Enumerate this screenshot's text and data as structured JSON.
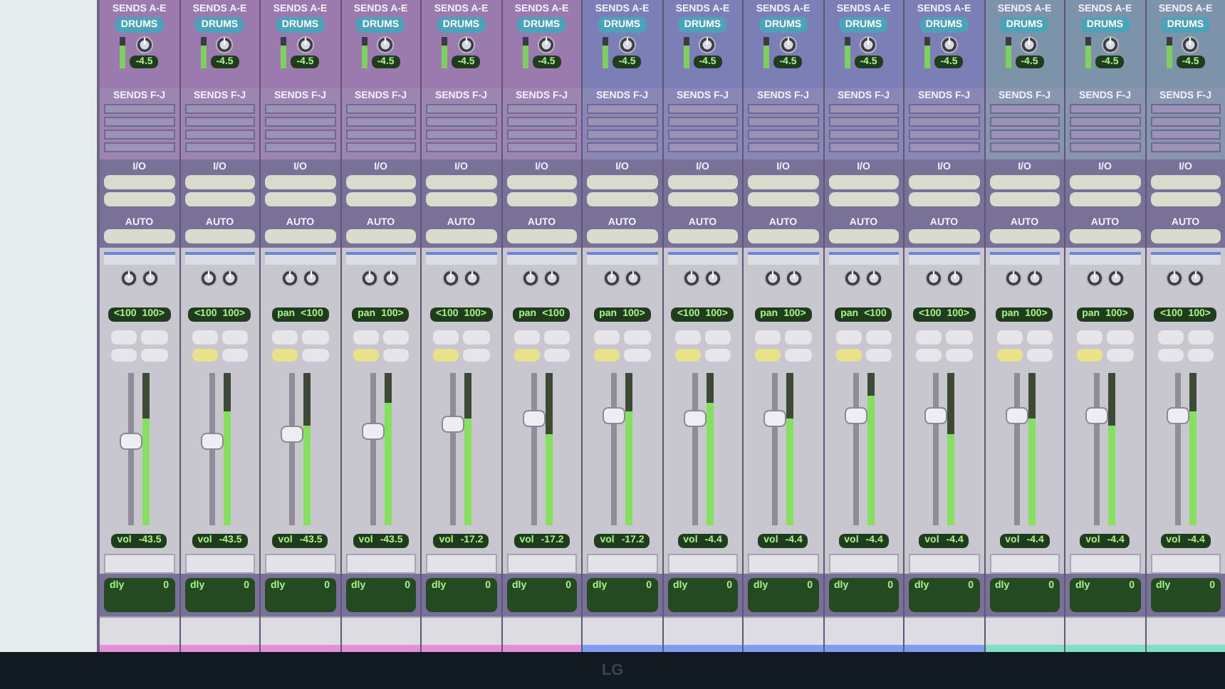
{
  "strips": [
    {
      "sends_ae": "SENDS A-E",
      "send": "DRUMS",
      "send_value": "-4.5",
      "sends_fj": "SENDS F-J",
      "io": "I/O",
      "auto": "AUTO",
      "pan_left": "<100",
      "pan_right": "100>",
      "fader": {
        "level": 0.55
      },
      "meter": {
        "level": 0.7
      },
      "vol_label": "vol",
      "vol": "-43.5",
      "dly_label": "dly",
      "dly": "0",
      "monitor": false,
      "color": "#e58fd6"
    },
    {
      "sends_ae": "SENDS A-E",
      "send": "DRUMS",
      "send_value": "-4.5",
      "sends_fj": "SENDS F-J",
      "io": "I/O",
      "auto": "AUTO",
      "pan_left": "<100",
      "pan_right": "100>",
      "fader": {
        "level": 0.55
      },
      "meter": {
        "level": 0.75
      },
      "vol_label": "vol",
      "vol": "-43.5",
      "dly_label": "dly",
      "dly": "0",
      "monitor": true,
      "color": "#e58fd6"
    },
    {
      "sends_ae": "SENDS A-E",
      "send": "DRUMS",
      "send_value": "-4.5",
      "sends_fj": "SENDS F-J",
      "io": "I/O",
      "auto": "AUTO",
      "pan_left": "pan",
      "pan_right": "<100",
      "fader": {
        "level": 0.6
      },
      "meter": {
        "level": 0.65
      },
      "vol_label": "vol",
      "vol": "-43.5",
      "dly_label": "dly",
      "dly": "0",
      "monitor": true,
      "color": "#e58fd6"
    },
    {
      "sends_ae": "SENDS A-E",
      "send": "DRUMS",
      "send_value": "-4.5",
      "sends_fj": "SENDS F-J",
      "io": "I/O",
      "auto": "AUTO",
      "pan_left": "pan",
      "pan_right": "100>",
      "fader": {
        "level": 0.62
      },
      "meter": {
        "level": 0.8
      },
      "vol_label": "vol",
      "vol": "-43.5",
      "dly_label": "dly",
      "dly": "0",
      "monitor": true,
      "color": "#e58fd6"
    },
    {
      "sends_ae": "SENDS A-E",
      "send": "DRUMS",
      "send_value": "-4.5",
      "sends_fj": "SENDS F-J",
      "io": "I/O",
      "auto": "AUTO",
      "pan_left": "<100",
      "pan_right": "100>",
      "fader": {
        "level": 0.66
      },
      "meter": {
        "level": 0.7
      },
      "vol_label": "vol",
      "vol": "-17.2",
      "dly_label": "dly",
      "dly": "0",
      "monitor": true,
      "color": "#e58fd6"
    },
    {
      "sends_ae": "SENDS A-E",
      "send": "DRUMS",
      "send_value": "-4.5",
      "sends_fj": "SENDS F-J",
      "io": "I/O",
      "auto": "AUTO",
      "pan_left": "pan",
      "pan_right": "<100",
      "fader": {
        "level": 0.7
      },
      "meter": {
        "level": 0.6
      },
      "vol_label": "vol",
      "vol": "-17.2",
      "dly_label": "dly",
      "dly": "0",
      "monitor": true,
      "color": "#e58fd6"
    },
    {
      "sends_ae": "SENDS A-E",
      "send": "DRUMS",
      "send_value": "-4.5",
      "sends_fj": "SENDS F-J",
      "io": "I/O",
      "auto": "AUTO",
      "pan_left": "pan",
      "pan_right": "100>",
      "fader": {
        "level": 0.72
      },
      "meter": {
        "level": 0.75
      },
      "vol_label": "vol",
      "vol": "-17.2",
      "dly_label": "dly",
      "dly": "0",
      "monitor": true,
      "color": "#7f9cf0"
    },
    {
      "sends_ae": "SENDS A-E",
      "send": "DRUMS",
      "send_value": "-4.5",
      "sends_fj": "SENDS F-J",
      "io": "I/O",
      "auto": "AUTO",
      "pan_left": "<100",
      "pan_right": "100>",
      "fader": {
        "level": 0.7
      },
      "meter": {
        "level": 0.8
      },
      "vol_label": "vol",
      "vol": "-4.4",
      "dly_label": "dly",
      "dly": "0",
      "monitor": true,
      "color": "#7f9cf0"
    },
    {
      "sends_ae": "SENDS A-E",
      "send": "DRUMS",
      "send_value": "-4.5",
      "sends_fj": "SENDS F-J",
      "io": "I/O",
      "auto": "AUTO",
      "pan_left": "pan",
      "pan_right": "100>",
      "fader": {
        "level": 0.7
      },
      "meter": {
        "level": 0.7
      },
      "vol_label": "vol",
      "vol": "-4.4",
      "dly_label": "dly",
      "dly": "0",
      "monitor": true,
      "color": "#7f9cf0"
    },
    {
      "sends_ae": "SENDS A-E",
      "send": "DRUMS",
      "send_value": "-4.5",
      "sends_fj": "SENDS F-J",
      "io": "I/O",
      "auto": "AUTO",
      "pan_left": "pan",
      "pan_right": "<100",
      "fader": {
        "level": 0.72
      },
      "meter": {
        "level": 0.85
      },
      "vol_label": "vol",
      "vol": "-4.4",
      "dly_label": "dly",
      "dly": "0",
      "monitor": true,
      "color": "#7f9cf0"
    },
    {
      "sends_ae": "SENDS A-E",
      "send": "DRUMS",
      "send_value": "-4.5",
      "sends_fj": "SENDS F-J",
      "io": "I/O",
      "auto": "AUTO",
      "pan_left": "<100",
      "pan_right": "100>",
      "fader": {
        "level": 0.72
      },
      "meter": {
        "level": 0.6
      },
      "vol_label": "vol",
      "vol": "-4.4",
      "dly_label": "dly",
      "dly": "0",
      "monitor": false,
      "color": "#7f9cf0"
    },
    {
      "sends_ae": "SENDS A-E",
      "send": "DRUMS",
      "send_value": "-4.5",
      "sends_fj": "SENDS F-J",
      "io": "I/O",
      "auto": "AUTO",
      "pan_left": "pan",
      "pan_right": "100>",
      "fader": {
        "level": 0.72
      },
      "meter": {
        "level": 0.7
      },
      "vol_label": "vol",
      "vol": "-4.4",
      "dly_label": "dly",
      "dly": "0",
      "monitor": true,
      "color": "#7fe0c8"
    },
    {
      "sends_ae": "SENDS A-E",
      "send": "DRUMS",
      "send_value": "-4.5",
      "sends_fj": "SENDS F-J",
      "io": "I/O",
      "auto": "AUTO",
      "pan_left": "pan",
      "pan_right": "100>",
      "fader": {
        "level": 0.72
      },
      "meter": {
        "level": 0.65
      },
      "vol_label": "vol",
      "vol": "-4.4",
      "dly_label": "dly",
      "dly": "0",
      "monitor": true,
      "color": "#7fe0c8"
    },
    {
      "sends_ae": "SENDS A-E",
      "send": "DRUMS",
      "send_value": "-4.5",
      "sends_fj": "SENDS F-J",
      "io": "I/O",
      "auto": "AUTO",
      "pan_left": "<100",
      "pan_right": "100>",
      "fader": {
        "level": 0.72
      },
      "meter": {
        "level": 0.75
      },
      "vol_label": "vol",
      "vol": "-4.4",
      "dly_label": "dly",
      "dly": "0",
      "monitor": false,
      "color": "#7fe0c8"
    }
  ],
  "monitor": {
    "logo": "LG"
  }
}
